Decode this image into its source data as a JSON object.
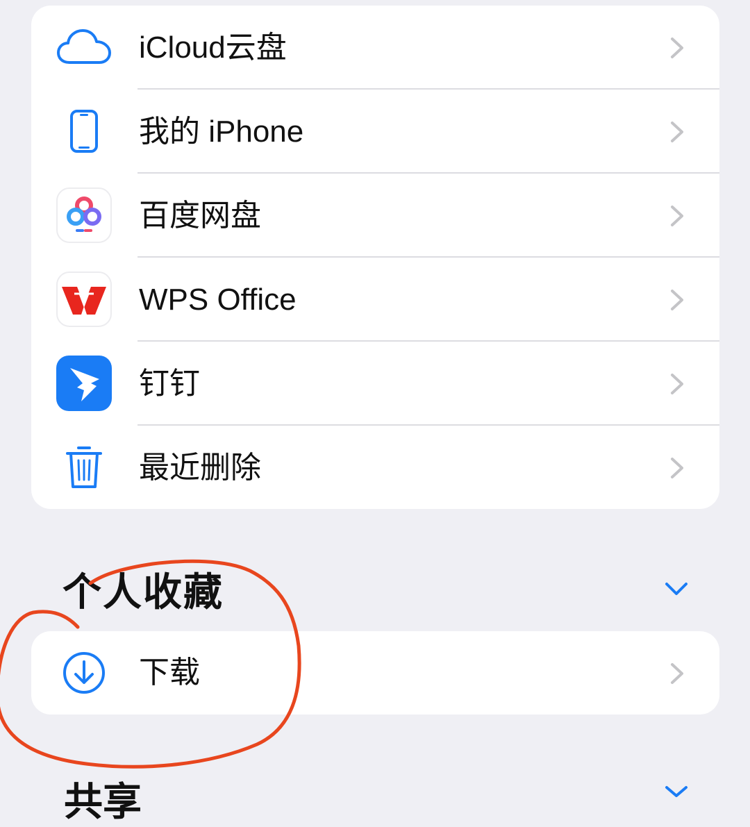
{
  "locations": {
    "items": [
      {
        "label": "iCloud云盘",
        "icon": "icloud-icon"
      },
      {
        "label": "我的 iPhone",
        "icon": "iphone-icon"
      },
      {
        "label": "百度网盘",
        "icon": "baidu-netdisk-icon"
      },
      {
        "label": "WPS Office",
        "icon": "wps-office-icon"
      },
      {
        "label": "钉钉",
        "icon": "dingtalk-icon"
      },
      {
        "label": "最近删除",
        "icon": "trash-icon"
      }
    ]
  },
  "favorites": {
    "title": "个人收藏",
    "toggle_icon": "chevron-down-icon",
    "items": [
      {
        "label": "下载",
        "icon": "download-circle-icon"
      }
    ]
  },
  "shared": {
    "title": "共享",
    "toggle_icon": "chevron-down-icon"
  },
  "colors": {
    "background": "#efeff4",
    "card": "#ffffff",
    "accent": "#1a7cf5",
    "chevron": "#c4c4c7",
    "annotation": "#e8461e"
  }
}
